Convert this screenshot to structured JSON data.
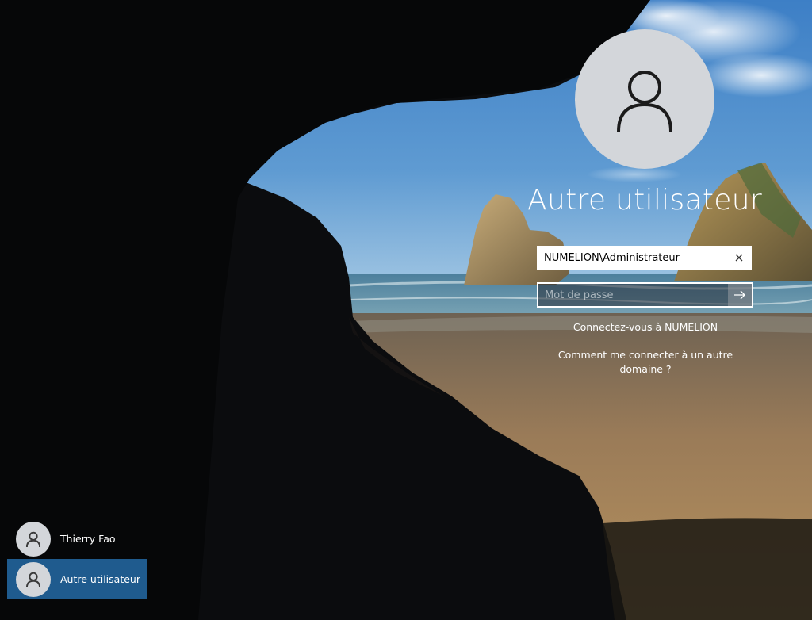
{
  "login": {
    "display_name": "Autre utilisateur",
    "username_value": "NUMELION\\Administrateur",
    "password_placeholder": "Mot de passe",
    "signin_to_link": "Connectez-vous à NUMELION",
    "other_domain_link_line1": "Comment me connecter à un autre",
    "other_domain_link_line2": "domaine ?"
  },
  "users": [
    {
      "label": "Thierry Fao",
      "selected": false
    },
    {
      "label": "Autre utilisateur",
      "selected": true
    }
  ],
  "icons": {
    "avatar": "user-silhouette-icon",
    "clear": "close-icon",
    "submit": "arrow-right-icon"
  },
  "colors": {
    "avatar_bg": "#d3d6da",
    "selected_user_bg": "#1f5b8e",
    "text": "#ffffff"
  }
}
